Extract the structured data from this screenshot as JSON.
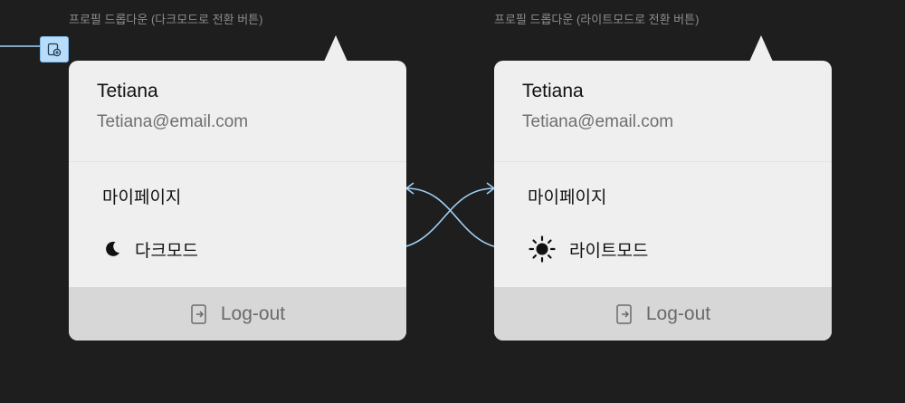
{
  "frames": [
    {
      "label": "프로필 드롭다운 (다크모드로 전환 버튼)",
      "user_name": "Tetiana",
      "user_email": "Tetiana@email.com",
      "menu_mypage": "마이페이지",
      "mode_label": "다크모드",
      "mode_icon": "moon-icon",
      "logout_label": "Log-out"
    },
    {
      "label": "프로필 드롭다운 (라이트모드로 전환 버튼)",
      "user_name": "Tetiana",
      "user_email": "Tetiana@email.com",
      "menu_mypage": "마이페이지",
      "mode_label": "라이트모드",
      "mode_icon": "sun-icon",
      "logout_label": "Log-out"
    }
  ],
  "colors": {
    "canvas": "#1e1e1e",
    "card": "#efefef",
    "logout_bar": "#d7d7d7",
    "connector": "#9fd0f7"
  }
}
